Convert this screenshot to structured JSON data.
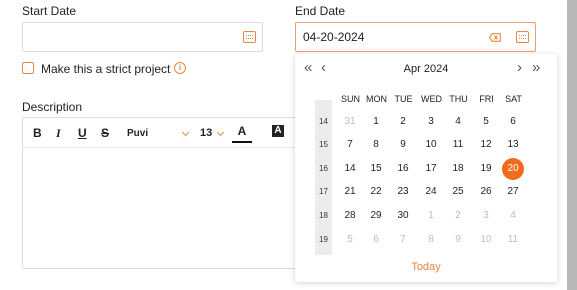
{
  "start_date": {
    "label": "Start Date",
    "value": ""
  },
  "end_date": {
    "label": "End Date",
    "value": "04-20-2024"
  },
  "strict_project": {
    "label": "Make this a strict project",
    "info_icon": "info-icon"
  },
  "description": {
    "label": "Description",
    "toolbar": {
      "bold": "B",
      "italic": "I",
      "underline": "U",
      "strikethrough": "S",
      "font": "Puvi",
      "size": "13",
      "text_color": "A",
      "bg_color": "A"
    }
  },
  "calendar": {
    "month": "Apr 2024",
    "prev_year": "«",
    "prev_month": "‹",
    "next_month": "›",
    "next_year": "»",
    "weekdays": [
      "SUN",
      "MON",
      "TUE",
      "WED",
      "THU",
      "FRI",
      "SAT"
    ],
    "weeks": [
      {
        "week": "14",
        "days": [
          "31",
          "1",
          "2",
          "3",
          "4",
          "5",
          "6"
        ],
        "muted": [
          true,
          false,
          false,
          false,
          false,
          false,
          false
        ]
      },
      {
        "week": "15",
        "days": [
          "7",
          "8",
          "9",
          "10",
          "11",
          "12",
          "13"
        ],
        "muted": [
          false,
          false,
          false,
          false,
          false,
          false,
          false
        ]
      },
      {
        "week": "16",
        "days": [
          "14",
          "15",
          "16",
          "17",
          "18",
          "19",
          "20"
        ],
        "muted": [
          false,
          false,
          false,
          false,
          false,
          false,
          false
        ]
      },
      {
        "week": "17",
        "days": [
          "21",
          "22",
          "23",
          "24",
          "25",
          "26",
          "27"
        ],
        "muted": [
          false,
          false,
          false,
          false,
          false,
          false,
          false
        ]
      },
      {
        "week": "18",
        "days": [
          "28",
          "29",
          "30",
          "1",
          "2",
          "3",
          "4"
        ],
        "muted": [
          false,
          false,
          false,
          true,
          true,
          true,
          true
        ]
      },
      {
        "week": "19",
        "days": [
          "5",
          "6",
          "7",
          "8",
          "9",
          "10",
          "11"
        ],
        "muted": [
          true,
          true,
          true,
          true,
          true,
          true,
          true
        ]
      }
    ],
    "selected": "20",
    "today_label": "Today"
  },
  "colors": {
    "accent": "#e8873f",
    "selected": "#f26b1d",
    "border_active": "#f29b70"
  }
}
